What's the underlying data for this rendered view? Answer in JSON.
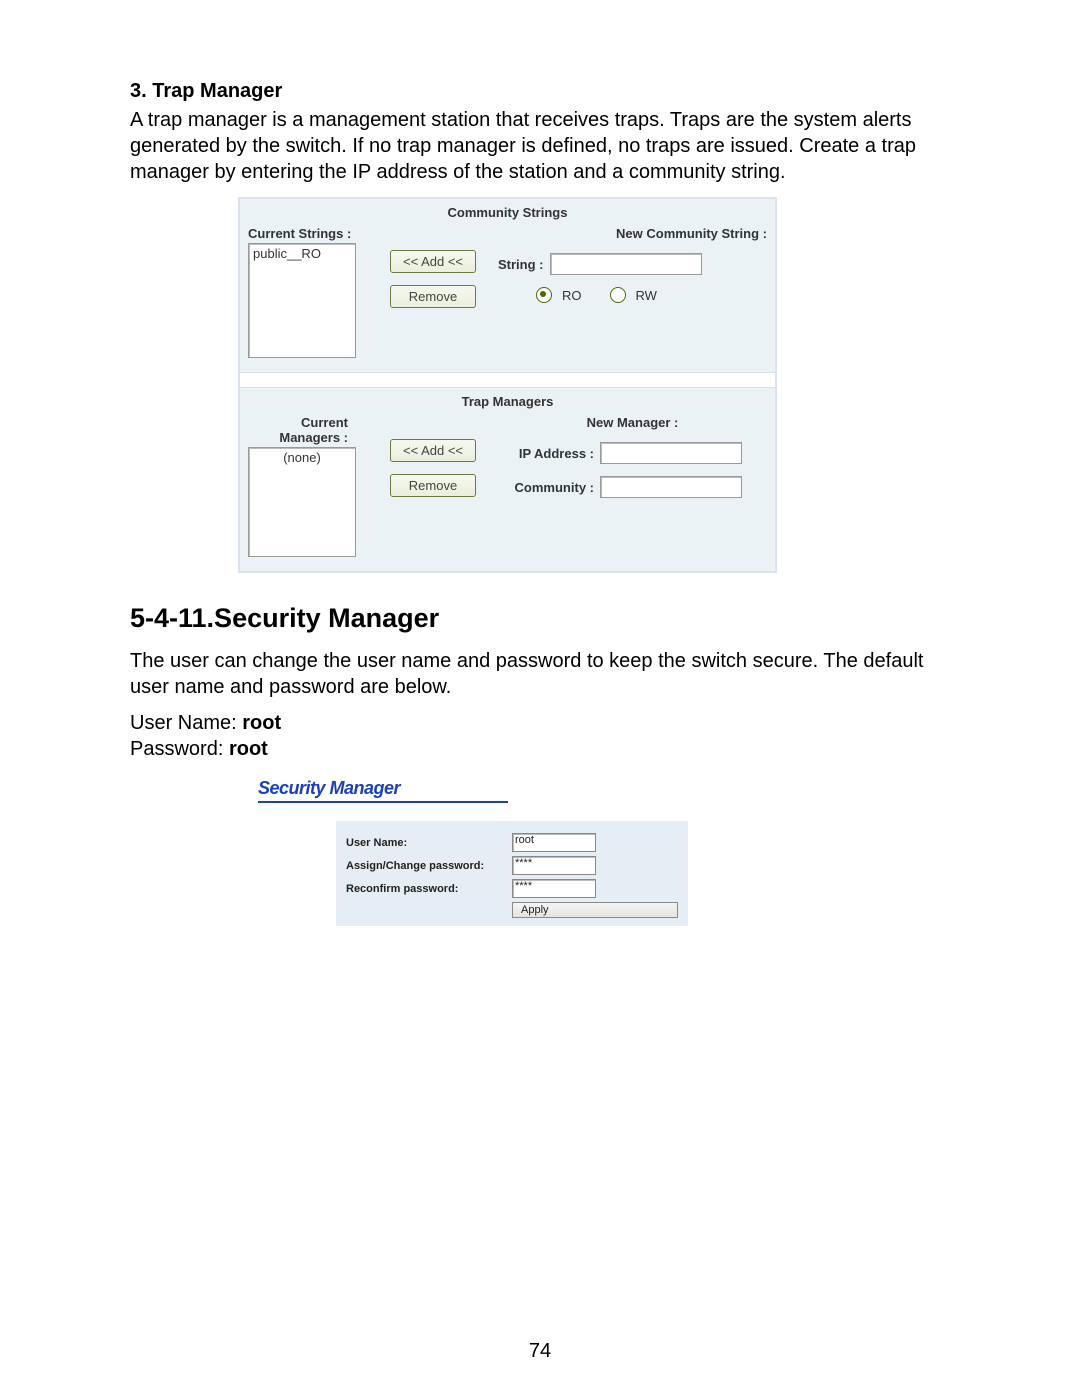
{
  "trap_heading": "3. Trap Manager",
  "trap_body": "A trap manager is a management station that receives traps.  Traps are the system alerts generated by the switch. If no trap manager is defined, no traps are issued. Create a trap manager by entering the IP address of the station and a community string.",
  "community": {
    "title": "Community Strings",
    "current_label": "Current Strings :",
    "current_value": "public__RO",
    "add_btn": "<< Add <<",
    "remove_btn": "Remove",
    "new_label": "New Community String :",
    "string_label": "String :",
    "string_value": "",
    "ro_label": "RO",
    "rw_label": "RW",
    "selected": "RO"
  },
  "trapmgr": {
    "title": "Trap Managers",
    "current_label": "Current Managers :",
    "current_value": "(none)",
    "add_btn": "<< Add <<",
    "remove_btn": "Remove",
    "new_label": "New Manager :",
    "ip_label": "IP Address :",
    "ip_value": "",
    "comm_label": "Community :",
    "comm_value": ""
  },
  "sec_heading": "5-4-11.Security Manager",
  "sec_body_1": "The user can change the user name and password to keep the switch secure.  The default user name and password are below.",
  "sec_un_label": "User Name: ",
  "sec_un_value": "root",
  "sec_pw_label": "Password: ",
  "sec_pw_value": "root",
  "sm": {
    "title": "Security Manager",
    "user_label": "User Name:",
    "user_value": "root",
    "pw_label": "Assign/Change password:",
    "pw_value": "****",
    "pw2_label": "Reconfirm password:",
    "pw2_value": "****",
    "apply": "Apply"
  },
  "page_number": "74"
}
